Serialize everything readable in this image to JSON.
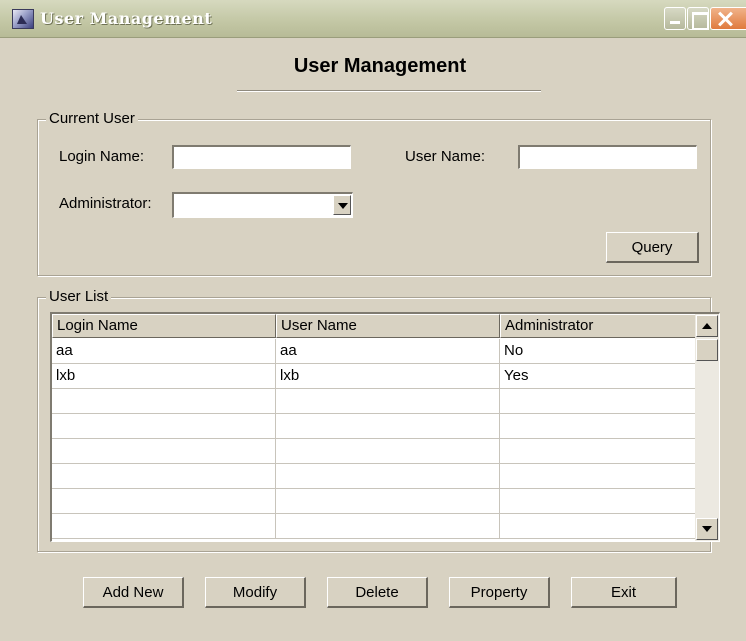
{
  "window": {
    "title": "User Management",
    "controls": {
      "minimize_icon": "minimize-icon",
      "maximize_icon": "maximize-icon",
      "close_icon": "close-icon"
    }
  },
  "heading": "User Management",
  "current_user": {
    "legend": "Current User",
    "login_name_label": "Login Name:",
    "login_name_value": "",
    "user_name_label": "User Name:",
    "user_name_value": "",
    "administrator_label": "Administrator:",
    "administrator_value": "",
    "query_label": "Query"
  },
  "user_list": {
    "legend": "User List",
    "columns": [
      "Login Name",
      "User Name",
      "Administrator"
    ],
    "rows": [
      [
        "aa",
        "aa",
        "No"
      ],
      [
        "lxb",
        "lxb",
        "Yes"
      ],
      [
        "",
        "",
        ""
      ],
      [
        "",
        "",
        ""
      ],
      [
        "",
        "",
        ""
      ],
      [
        "",
        "",
        ""
      ],
      [
        "",
        "",
        ""
      ],
      [
        "",
        "",
        ""
      ]
    ]
  },
  "actions": {
    "add_new": "Add New",
    "modify": "Modify",
    "delete": "Delete",
    "property": "Property",
    "exit": "Exit"
  },
  "colors": {
    "window_bg": "#d8d2c2",
    "titlebar": "#c4c8a6",
    "close_button": "#e07a3e"
  }
}
